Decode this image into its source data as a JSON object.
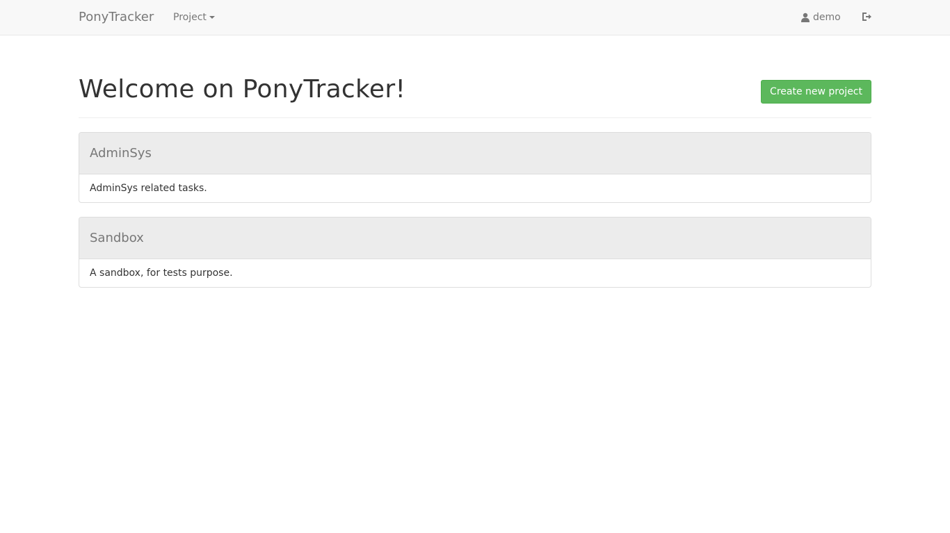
{
  "navbar": {
    "brand": "PonyTracker",
    "project_menu_label": "Project",
    "user_label": "demo",
    "user_icon": "user-icon",
    "logout_icon": "logout-icon"
  },
  "header": {
    "title": "Welcome on PonyTracker!",
    "create_button_label": "Create new project"
  },
  "projects": [
    {
      "name": "AdminSys",
      "description": "AdminSys related tasks."
    },
    {
      "name": "Sandbox",
      "description": "A sandbox, for tests purpose."
    }
  ],
  "colors": {
    "success": "#5cb85c",
    "navbar_bg": "#f8f8f8",
    "panel_heading_bg": "#ececec"
  }
}
